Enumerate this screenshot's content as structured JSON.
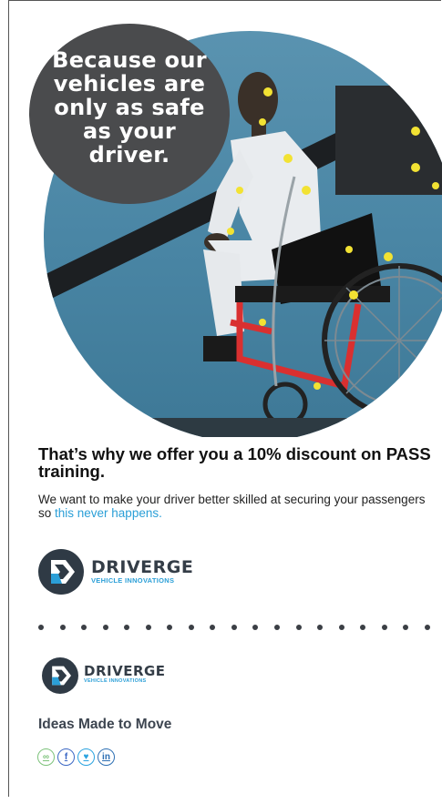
{
  "hero": {
    "quote": "Because our vehicles are only as safe as your driver."
  },
  "content": {
    "headline": "That’s why we offer you a 10% discount on PASS training.",
    "body_prefix": "We want to make your driver better skilled at securing your passengers so ",
    "body_link": "this never happens."
  },
  "brand": {
    "name": "DRIVERGE",
    "sub": "VEHICLE INNOVATIONS",
    "tagline": "Ideas Made to Move"
  },
  "social_icons": [
    {
      "name": "link-icon",
      "glyph": "∞",
      "color": "#7cc27a"
    },
    {
      "name": "facebook-icon",
      "glyph": "f",
      "color": "#3b67c4"
    },
    {
      "name": "twitter-icon",
      "glyph": "♥",
      "color": "#2aa3e0"
    },
    {
      "name": "linkedin-icon",
      "glyph": "in",
      "color": "#2d6fb3"
    }
  ],
  "colors": {
    "accent": "#2b9fd7",
    "dark": "#4a4b4d"
  }
}
